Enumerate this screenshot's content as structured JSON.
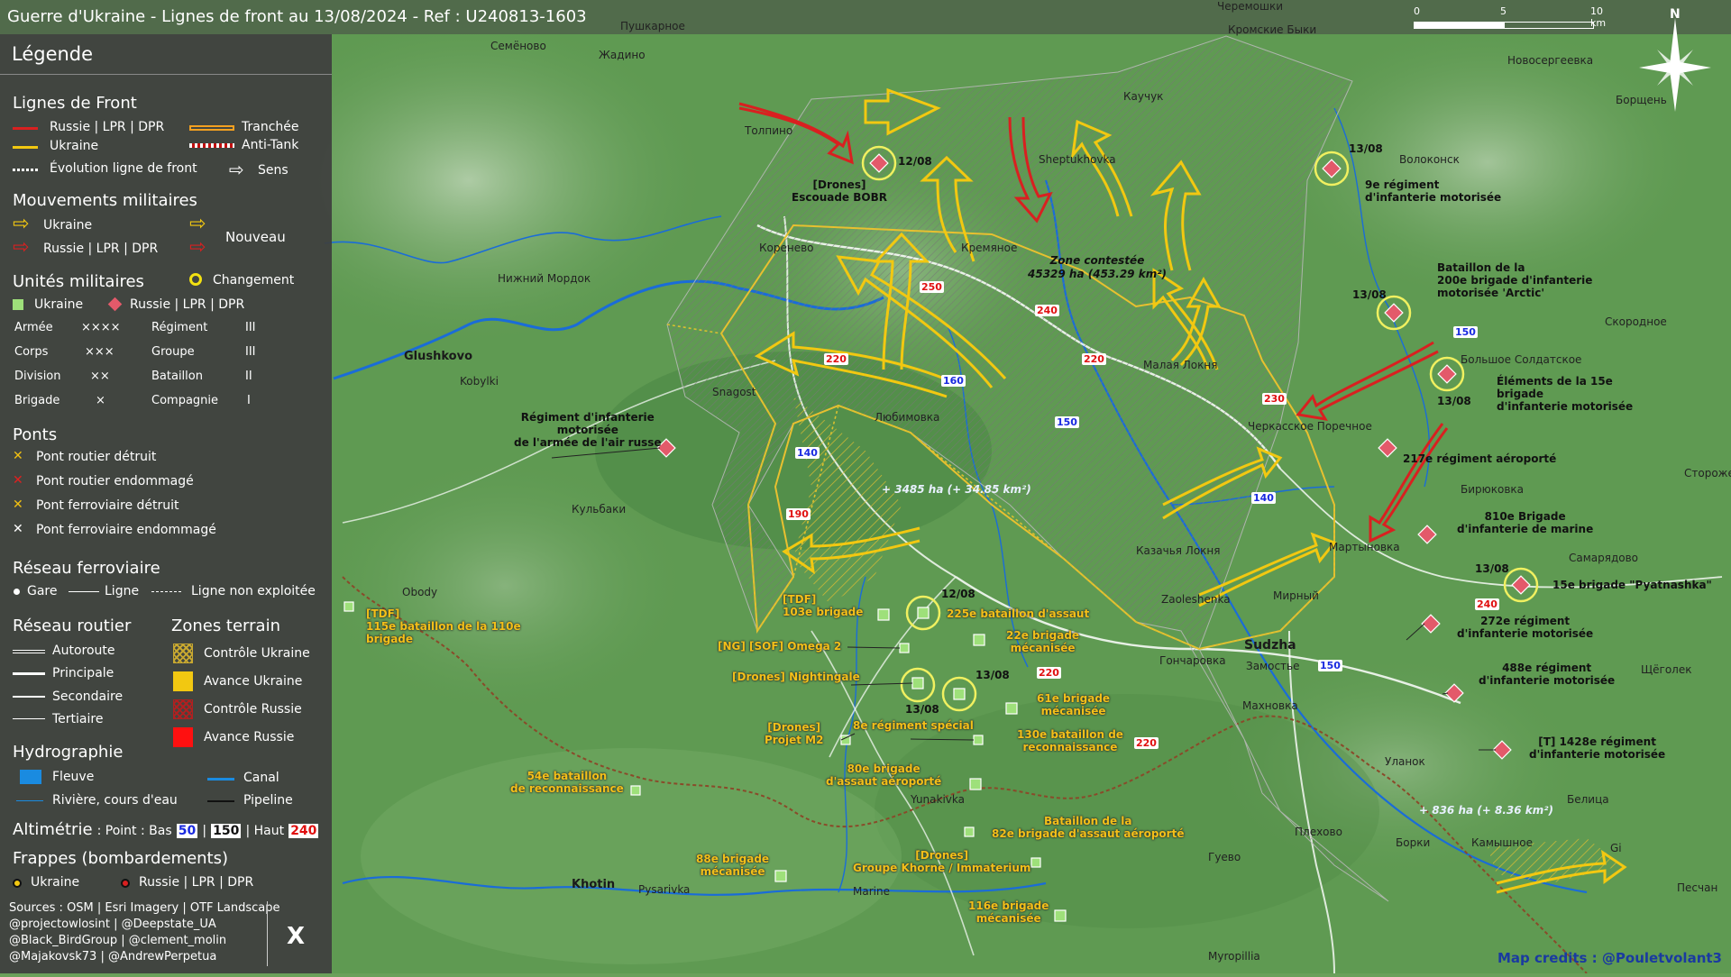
{
  "header": {
    "title": "Guerre d'Ukraine - Lignes de front au 13/08/2024 - Ref : U240813-1603",
    "scale": {
      "labels": [
        "0",
        "5",
        "10 km"
      ]
    },
    "north": "N"
  },
  "legend": {
    "title": "Légende",
    "front_lines": {
      "heading": "Lignes de Front",
      "russia": "Russie | LPR | DPR",
      "trench": "Tranchée",
      "ukraine": "Ukraine",
      "antitank": "Anti-Tank",
      "evolution": "Évolution ligne de front",
      "direction": "Sens"
    },
    "movements": {
      "heading": "Mouvements militaires",
      "ukraine": "Ukraine",
      "russia": "Russie | LPR | DPR",
      "new": "Nouveau"
    },
    "units": {
      "heading": "Unités militaires",
      "change": "Changement",
      "ukraine": "Ukraine",
      "russia": "Russie | LPR | DPR",
      "rows": [
        {
          "name": "Armée",
          "sym": "××××",
          "name2": "Régiment",
          "sym2": "III"
        },
        {
          "name": "Corps",
          "sym": "×××",
          "name2": "Groupe",
          "sym2": "III"
        },
        {
          "name": "Division",
          "sym": "××",
          "name2": "Bataillon",
          "sym2": "II"
        },
        {
          "name": "Brigade",
          "sym": "×",
          "name2": "Compagnie",
          "sym2": "I"
        }
      ]
    },
    "bridges": {
      "heading": "Ponts",
      "items": [
        {
          "label": "Pont routier détruit",
          "color": "#f2c011"
        },
        {
          "label": "Pont routier endommagé",
          "color": "#e02020"
        },
        {
          "label": "Pont ferroviaire détruit",
          "color": "#f2c011"
        },
        {
          "label": "Pont ferroviaire endommagé",
          "color": "#ffffff"
        }
      ]
    },
    "rail": {
      "heading": "Réseau ferroviaire",
      "station": "Gare",
      "line": "Ligne",
      "unused": "Ligne non exploitée"
    },
    "roads": {
      "heading": "Réseau routier",
      "items": [
        "Autoroute",
        "Principale",
        "Secondaire",
        "Tertiaire"
      ]
    },
    "zones": {
      "heading": "Zones terrain",
      "items": [
        {
          "label": "Contrôle Ukraine",
          "color": "#c8a830"
        },
        {
          "label": "Avance Ukraine",
          "color": "#f2c811"
        },
        {
          "label": "Contrôle Russie",
          "color": "#b02020"
        },
        {
          "label": "Avance Russie",
          "color": "#ff1010"
        }
      ]
    },
    "hydro": {
      "heading": "Hydrographie",
      "river": "Fleuve",
      "canal": "Canal",
      "stream": "Rivière, cours d'eau",
      "pipeline": "Pipeline"
    },
    "altimetry": {
      "heading": "Altimétrie",
      "text": ": Point : Bas",
      "low": "50",
      "mid": "150",
      "high_text": "| Haut",
      "high": "240"
    },
    "strikes": {
      "heading": "Frappes (bombardements)",
      "ukraine": "Ukraine",
      "russia": "Russie | LPR | DPR"
    },
    "sources": [
      "Sources : OSM | Esri Imagery | OTF Landscape",
      "@projectowlosint | @Deepstate_UA",
      "@Black_BirdGroup | @clement_molin",
      "@Majakovsk73 | @AndrewPerpetua"
    ],
    "x_logo": "X"
  },
  "map": {
    "towns": [
      {
        "name": "Glushkovo"
      },
      {
        "name": "Snagost"
      },
      {
        "name": "Kobylki"
      },
      {
        "name": "Кульбаки"
      },
      {
        "name": "Obody"
      },
      {
        "name": "Толпино"
      },
      {
        "name": "Коренево"
      },
      {
        "name": "Кремяное"
      },
      {
        "name": "Sheptukhovka"
      },
      {
        "name": "Каучук"
      },
      {
        "name": "Любимовка"
      },
      {
        "name": "Малая Локня"
      },
      {
        "name": "Черкасское Поречное"
      },
      {
        "name": "Казачья Локня"
      },
      {
        "name": "Мартыновка"
      },
      {
        "name": "Zaoleshenka"
      },
      {
        "name": "Sudzha"
      },
      {
        "name": "Мирный"
      },
      {
        "name": "Гончаровка"
      },
      {
        "name": "Замостье"
      },
      {
        "name": "Махновка"
      },
      {
        "name": "Уланок"
      },
      {
        "name": "Плехово"
      },
      {
        "name": "Гуево"
      },
      {
        "name": "Борки"
      },
      {
        "name": "Камышное"
      },
      {
        "name": "Gi"
      },
      {
        "name": "Белица"
      },
      {
        "name": "Yunakivka"
      },
      {
        "name": "Khotin"
      },
      {
        "name": "Pysarivka"
      },
      {
        "name": "Marine"
      },
      {
        "name": "Myropillia"
      },
      {
        "name": "Волоконск"
      },
      {
        "name": "Скородное"
      },
      {
        "name": "Большое Солдатское"
      },
      {
        "name": "Бирюковка"
      },
      {
        "name": "Самарядово"
      },
      {
        "name": "Стороже"
      },
      {
        "name": "Щёголек"
      },
      {
        "name": "Песчан"
      },
      {
        "name": "Борщень"
      },
      {
        "name": "Новосергеевка"
      },
      {
        "name": "Семёново"
      },
      {
        "name": "Жадино"
      },
      {
        "name": "Пушкарное"
      },
      {
        "name": "Кромские Быки"
      },
      {
        "name": "Черемошки"
      },
      {
        "name": "Нижний Мордок"
      },
      {
        "name": "Любимовка"
      }
    ],
    "zones": [
      {
        "line1": "Zone contestée",
        "line2": "45329 ha (453.29 km²)"
      },
      {
        "line1": "+ 3485 ha (+ 34.85 km²)"
      },
      {
        "line1": "+ 836 ha (+ 8.36 km²)"
      }
    ],
    "russian_units": [
      {
        "date": "12/08",
        "line1": "[Drones]",
        "line2": "Escouade BOBR"
      },
      {
        "date": "13/08",
        "line1": "9e régiment",
        "line2": "d'infanterie motorisée"
      },
      {
        "date": "13/08",
        "line1": "Bataillon de la",
        "line2": "200e brigade d'infanterie",
        "line3": "motorisée 'Arctic'"
      },
      {
        "date": "13/08",
        "line1": "Éléments de la 15e",
        "line2": "brigade",
        "line3": "d'infanterie motorisée"
      },
      {
        "line1": "Régiment d'infanterie",
        "line2": "motorisée",
        "line3": "de l'armée de l'air russe"
      },
      {
        "line1": "217e régiment aéroporté"
      },
      {
        "line1": "810e Brigade",
        "line2": "d'infanterie de marine"
      },
      {
        "date": "13/08",
        "line1": "15e brigade \"Pyatnashka\""
      },
      {
        "line1": "272e régiment",
        "line2": "d'infanterie motorisée"
      },
      {
        "line1": "488e régiment",
        "line2": "d'infanterie motorisée"
      },
      {
        "line1": "[T] 1428e régiment",
        "line2": "d'infanterie motorisée"
      }
    ],
    "ukraine_units": [
      {
        "line1": "[TDF]",
        "line2": "115e bataillon de la 110e",
        "line3": "brigade"
      },
      {
        "line1": "[TDF]",
        "line2": "103e brigade"
      },
      {
        "date": "12/08",
        "line1": "225e bataillon d'assaut"
      },
      {
        "line1": "22e brigade",
        "line2": "mécanisée"
      },
      {
        "line1": "[NG] [SOF] Omega 2"
      },
      {
        "line1": "[Drones] Nightingale"
      },
      {
        "date": "13/08",
        "date2": "13/08"
      },
      {
        "line1": "61e brigade",
        "line2": "mécanisée"
      },
      {
        "line1": "[Drones]",
        "line2": "Projet M2"
      },
      {
        "line1": "8e régiment spécial"
      },
      {
        "line1": "130e bataillon de",
        "line2": "reconnaissance"
      },
      {
        "line1": "54e bataillon",
        "line2": "de reconnaissance"
      },
      {
        "line1": "80e brigade",
        "line2": "d'assaut aéroporté"
      },
      {
        "line1": "Bataillon de la",
        "line2": "82e brigade d'assaut aéroporté"
      },
      {
        "line1": "88e brigade",
        "line2": "mécanisée"
      },
      {
        "line1": "[Drones]",
        "line2": "Groupe Khorne / Immaterium"
      },
      {
        "line1": "116e brigade",
        "line2": "mécanisée"
      }
    ],
    "altitudes_red": [
      "250",
      "240",
      "220",
      "220",
      "230",
      "190",
      "240",
      "220",
      "220"
    ],
    "altitudes_blue": [
      "160",
      "150",
      "140",
      "140",
      "150",
      "150"
    ]
  },
  "credits": "Map credits : @Pouletvolant3",
  "colors": {
    "ukraine": "#f2c811",
    "russia": "#d92020",
    "legend_bg": "#3e3e3e",
    "map_green": "#6aa05a",
    "water": "#1a6cd8"
  }
}
